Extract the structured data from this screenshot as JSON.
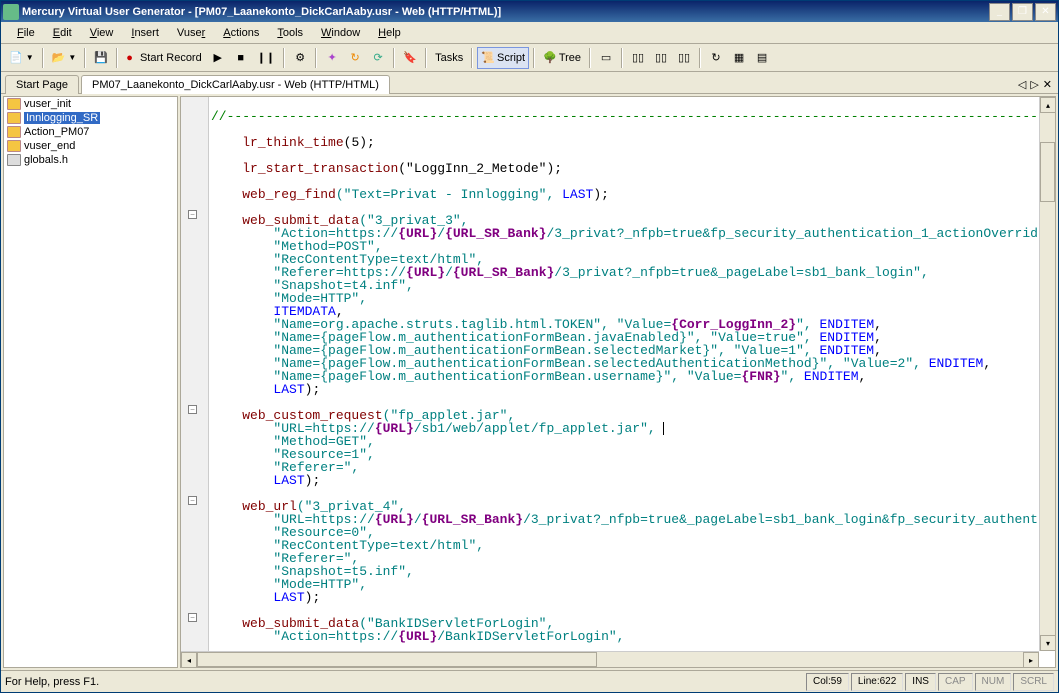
{
  "window": {
    "title": "Mercury Virtual User Generator - [PM07_Laanekonto_DickCarlAaby.usr - Web (HTTP/HTML)]"
  },
  "menu": [
    "File",
    "Edit",
    "View",
    "Insert",
    "Vuser",
    "Actions",
    "Tools",
    "Window",
    "Help"
  ],
  "toolbar": {
    "start_record": "Start Record",
    "tasks": "Tasks",
    "script": "Script",
    "tree": "Tree"
  },
  "tabs": {
    "start": "Start Page",
    "doc": "PM07_Laanekonto_DickCarlAaby.usr - Web (HTTP/HTML)"
  },
  "tree": {
    "items": [
      {
        "label": "vuser_init",
        "icon": "script"
      },
      {
        "label": "Innlogging_SR",
        "icon": "script",
        "selected": true
      },
      {
        "label": "Action_PM07",
        "icon": "script"
      },
      {
        "label": "vuser_end",
        "icon": "script"
      },
      {
        "label": "globals.h",
        "icon": "header"
      }
    ]
  },
  "code": {
    "t_comment": "//------------------------------------------------------------------------------------------------------------",
    "t_think": "lr_think_time",
    "t_5": "(5);",
    "t_start_trans": "lr_start_transaction",
    "t_logginn": "(\"LoggInn_2_Metode\");",
    "t_wrf": "web_reg_find",
    "t_wrf_arg": "(\"Text=Privat - Innlogging\", ",
    "t_last1": "LAST",
    "t_close1": ");",
    "t_wsd": "web_submit_data",
    "t_wsd_3p3": "(\"3_privat_3\",",
    "t_act1a": "        \"Action=https://",
    "t_url": "{URL}",
    "t_slash": "/",
    "t_urlsr": "{URL_SR_Bank}",
    "t_act1b": "/3_privat?_nfpb=true&fp_security_authentication_1_actionOverrid",
    "t_mpost": "        \"Method=POST\",",
    "t_rct": "        \"RecContentType=text/html\",",
    "t_ref1a": "        \"Referer=https://",
    "t_ref1b": "/3_privat?_nfpb=true&_pageLabel=sb1_bank_login\",",
    "t_snap4": "        \"Snapshot=t4.inf\",",
    "t_mhttp": "        \"Mode=HTTP\",",
    "t_item": "        ",
    "t_itemdata": "ITEMDATA",
    "t_comma": ",",
    "t_tok1": "        \"Name=org.apache.struts.taglib.html.TOKEN\", \"Value=",
    "t_corr": "{Corr_LoggInn_2}",
    "t_tok2": "\", ",
    "t_enditem": "ENDITEM",
    "t_je": "        \"Name={pageFlow.m_authenticationFormBean.javaEnabled}\", \"Value=true\", ",
    "t_sm": "        \"Name={pageFlow.m_authenticationFormBean.selectedMarket}\", \"Value=1\", ",
    "t_sam": "        \"Name={pageFlow.m_authenticationFormBean.selectedAuthenticationMethod}\", \"Value=2\", ",
    "t_un1": "        \"Name={pageFlow.m_authenticationFormBean.username}\", \"Value=",
    "t_fnr": "{FNR}",
    "t_un2": "\", ",
    "t_last8": "        ",
    "t_last": "LAST",
    "t_close": ");",
    "t_wcr": "web_custom_request",
    "t_wcr_a": "(\"fp_applet.jar\",",
    "t_curl1": "        \"URL=https://",
    "t_curl2": "/sb1/web/applet/fp_applet.jar\", ",
    "t_mget": "        \"Method=GET\",",
    "t_res1": "        \"Resource=1\",",
    "t_refe": "        \"Referer=\",",
    "t_wurl": "web_url",
    "t_wurl_a": "(\"3_privat_4\",",
    "t_wurl1a": "        \"URL=https://",
    "t_wurl1b": "/3_privat?_nfpb=true&_pageLabel=sb1_bank_login&fp_security_authent",
    "t_res0": "        \"Resource=0\",",
    "t_snap5": "        \"Snapshot=t5.inf\",",
    "t_wsd2a": "(\"BankIDServletForLogin\",",
    "t_bank1": "        \"Action=https://",
    "t_bank2": "/BankIDServletForLogin\","
  },
  "status": {
    "help": "For Help, press F1.",
    "col": "Col:59",
    "line": "Line:622",
    "ins": "INS",
    "cap": "CAP",
    "num": "NUM",
    "scrl": "SCRL"
  }
}
